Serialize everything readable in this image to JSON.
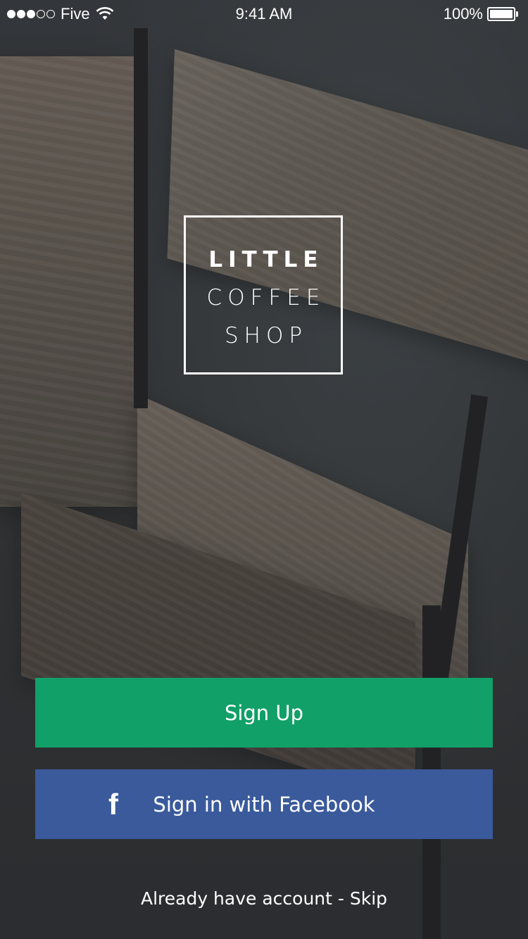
{
  "status_bar": {
    "carrier": "Five",
    "time": "9:41 AM",
    "battery": "100%",
    "signal_strength": 3,
    "signal_max": 5
  },
  "logo": {
    "line1": "LITTLE",
    "line2": "COFFEE",
    "line3": "SHOP"
  },
  "buttons": {
    "signup_label": "Sign Up",
    "facebook_label": "Sign in with Facebook",
    "facebook_icon_glyph": "f"
  },
  "footer": {
    "account_text": "Already have account - ",
    "skip_label": "Skip"
  },
  "colors": {
    "signup": "#11a067",
    "facebook": "#3a5a9b"
  }
}
